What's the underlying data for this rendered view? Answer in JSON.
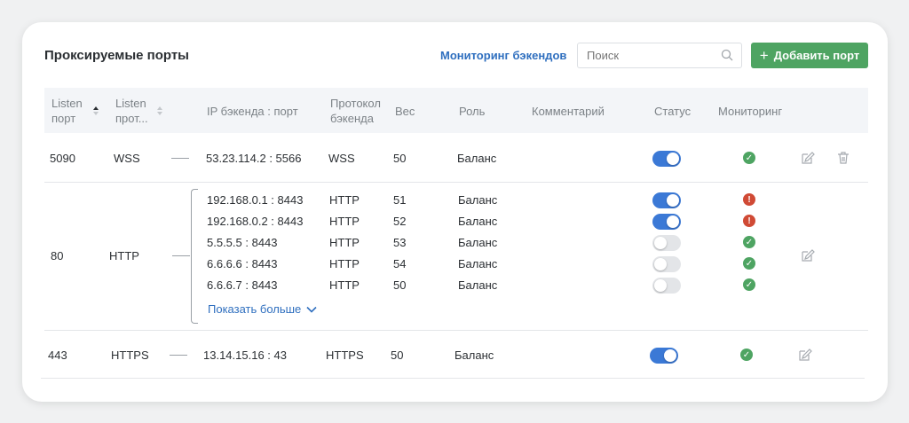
{
  "header": {
    "title": "Проксируемые порты",
    "monitoring_link": "Мониторинг бэкендов",
    "search_placeholder": "Поиск",
    "add_button": "Добавить порт"
  },
  "columns": {
    "listen_port": [
      "Listen",
      "порт"
    ],
    "listen_proto": [
      "Listen",
      "прот..."
    ],
    "backend_ip": "IP бэкенда : порт",
    "backend_proto": [
      "Протокол",
      "бэкенда"
    ],
    "weight": "Вес",
    "role": "Роль",
    "comment": "Комментарий",
    "status": "Статус",
    "monitoring": "Мониторинг"
  },
  "rows": [
    {
      "port": "5090",
      "proto": "WSS",
      "backends": [
        {
          "ip": "53.23.114.2 : 5566",
          "proto": "WSS",
          "weight": "50",
          "role": "Баланс",
          "status": "on",
          "monitoring": "ok"
        }
      ]
    },
    {
      "port": "80",
      "proto": "HTTP",
      "backends": [
        {
          "ip": "192.168.0.1 : 8443",
          "proto": "HTTP",
          "weight": "51",
          "role": "Баланс",
          "status": "on",
          "monitoring": "error"
        },
        {
          "ip": "192.168.0.2 : 8443",
          "proto": "HTTP",
          "weight": "52",
          "role": "Баланс",
          "status": "on",
          "monitoring": "error"
        },
        {
          "ip": "5.5.5.5 : 8443",
          "proto": "HTTP",
          "weight": "53",
          "role": "Баланс",
          "status": "off",
          "monitoring": "ok"
        },
        {
          "ip": "6.6.6.6 : 8443",
          "proto": "HTTP",
          "weight": "54",
          "role": "Баланс",
          "status": "off",
          "monitoring": "ok"
        },
        {
          "ip": "6.6.6.7 : 8443",
          "proto": "HTTP",
          "weight": "50",
          "role": "Баланс",
          "status": "off",
          "monitoring": "ok"
        }
      ],
      "show_more": "Показать больше"
    },
    {
      "port": "443",
      "proto": "HTTPS",
      "backends": [
        {
          "ip": "13.14.15.16 : 43",
          "proto": "HTTPS",
          "weight": "50",
          "role": "Баланс",
          "status": "on",
          "monitoring": "ok"
        }
      ]
    }
  ],
  "colors": {
    "accent": "#3b79d6",
    "link": "#2f6fbf",
    "add_button": "#4ea462",
    "status_ok": "#4ea462",
    "status_error": "#d04a35"
  }
}
